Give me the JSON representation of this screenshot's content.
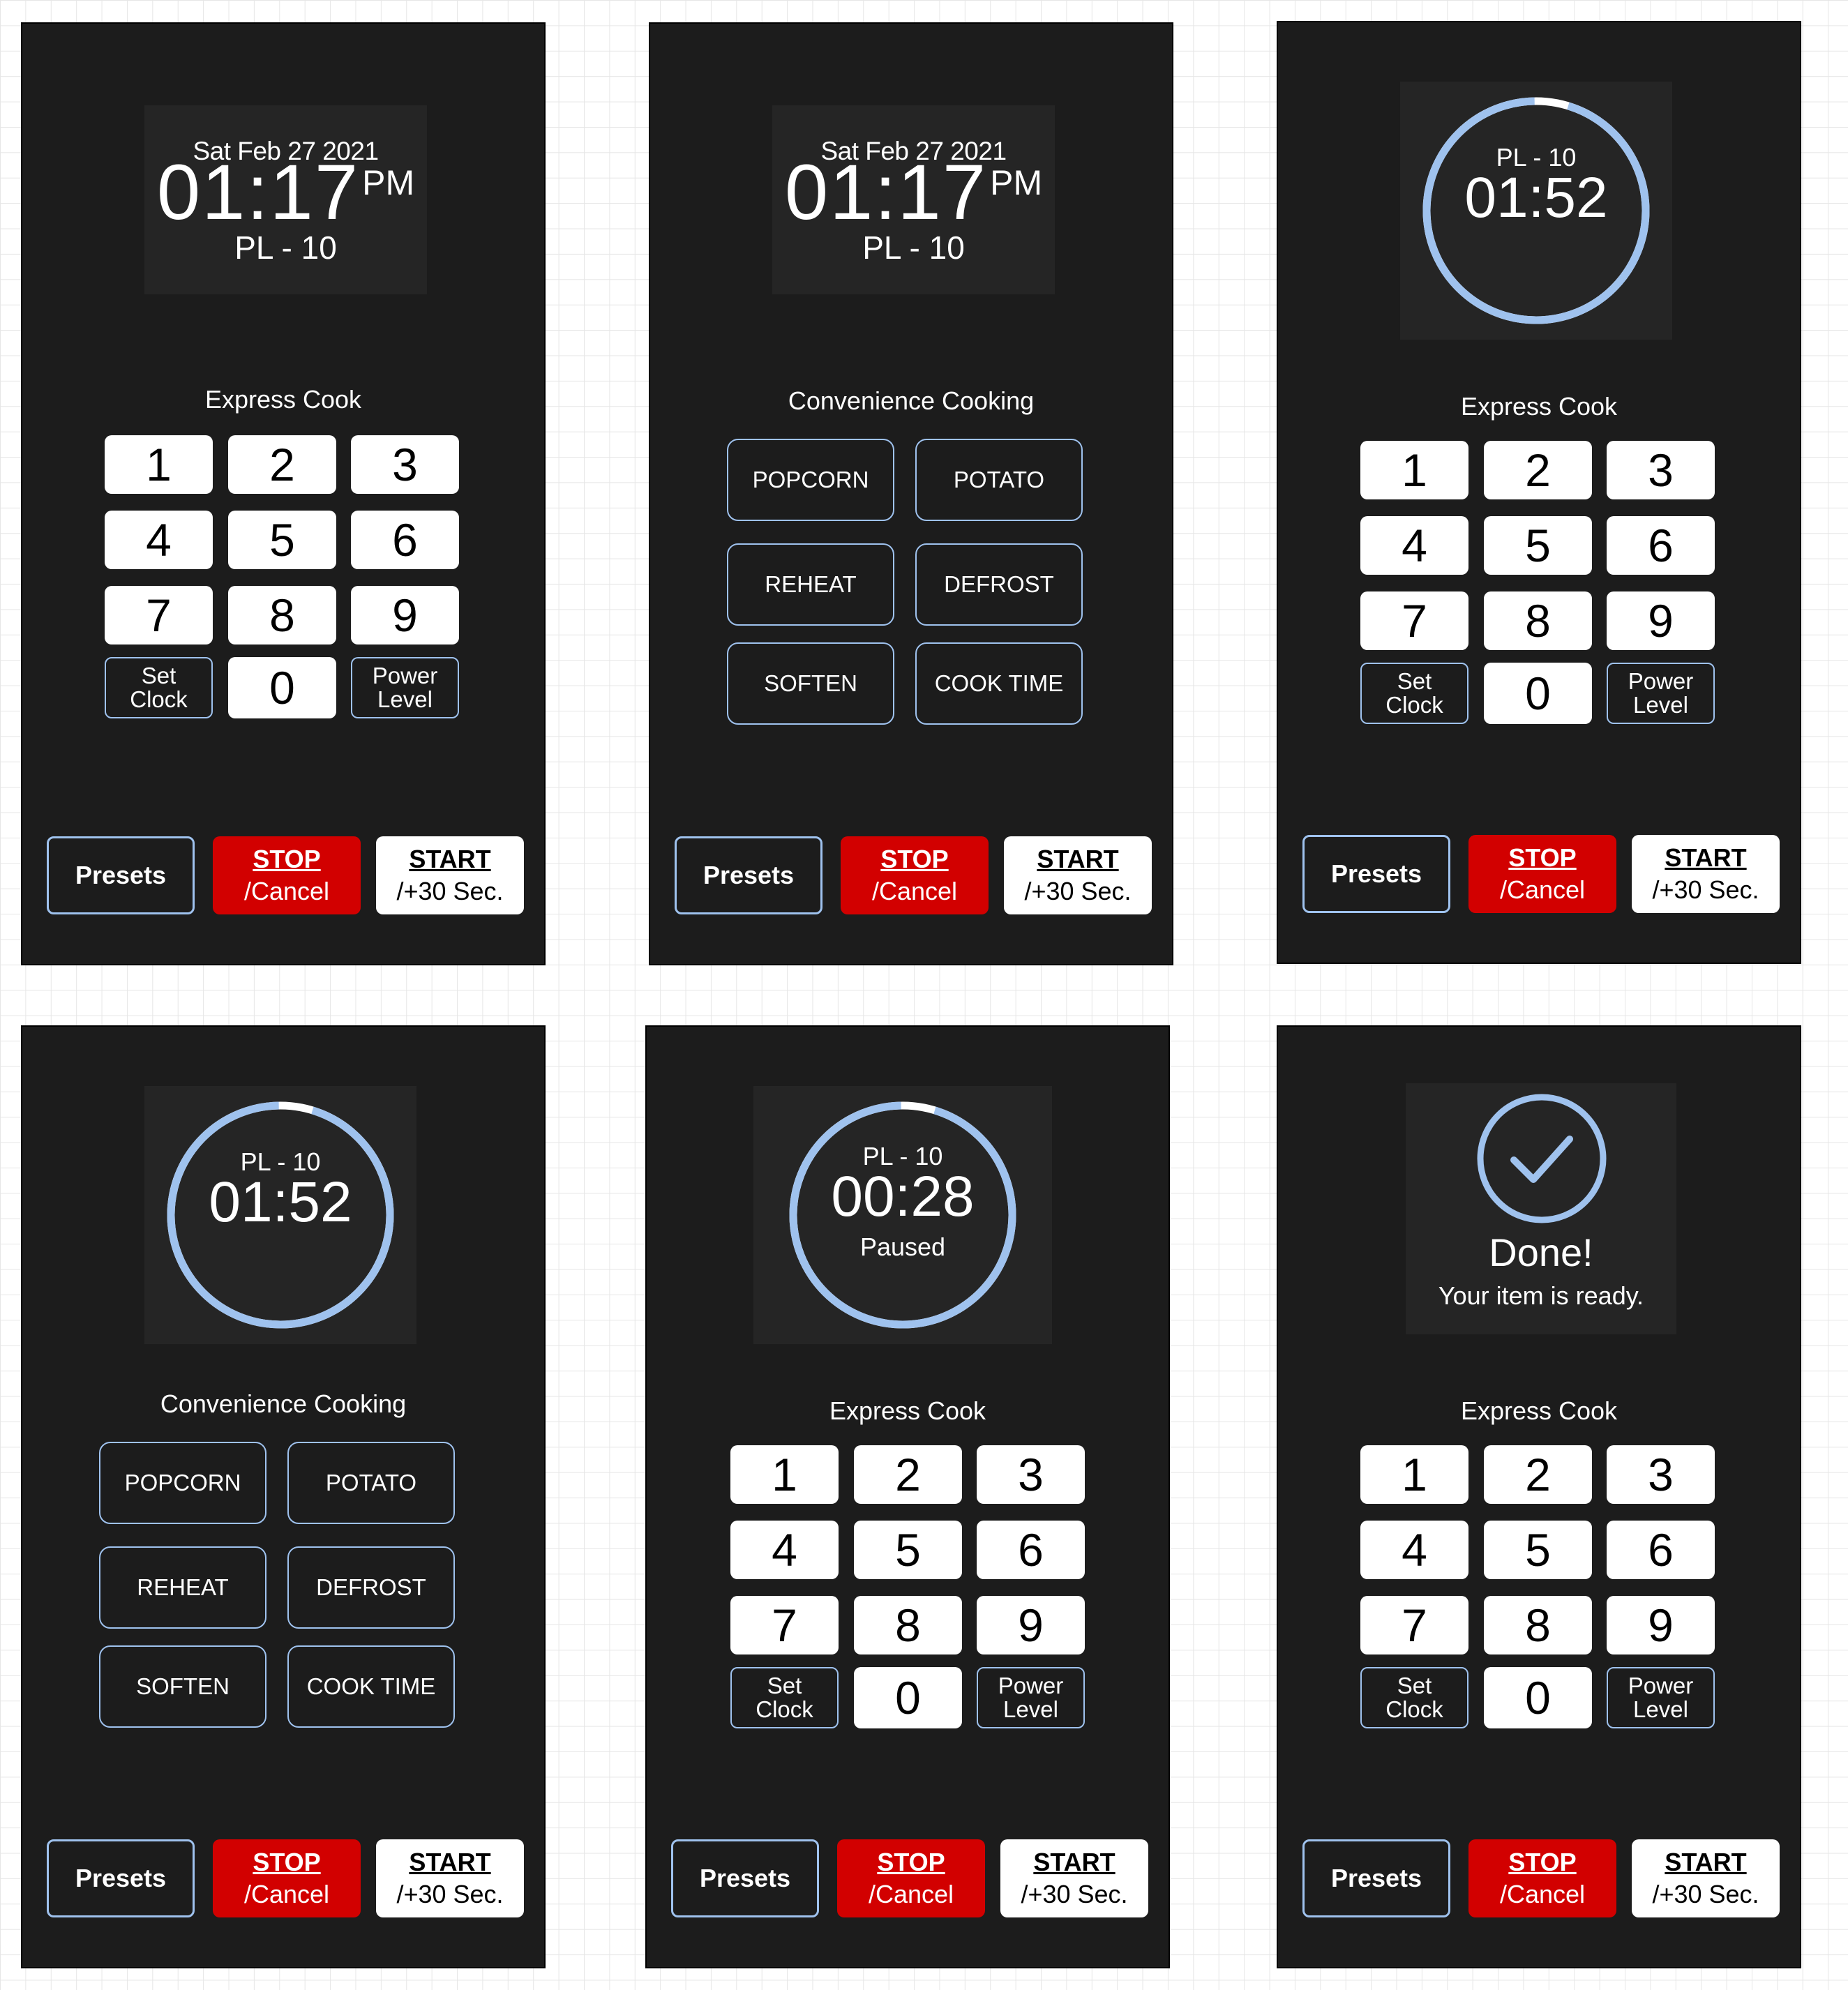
{
  "clock": {
    "date": "Sat Feb 27 2021",
    "time": "01:17",
    "ampm": "PM",
    "power_level": "PL - 10"
  },
  "cooking": {
    "power_level": "PL - 10",
    "time_running": "01:52",
    "time_paused": "00:28",
    "paused_label": "Paused",
    "progress_remaining": 0.95
  },
  "done": {
    "title": "Done!",
    "subtitle": "Your item is ready."
  },
  "sections": {
    "express": "Express Cook",
    "convenience": "Convenience Cooking"
  },
  "keypad": {
    "digits": [
      "1",
      "2",
      "3",
      "4",
      "5",
      "6",
      "7",
      "8",
      "9"
    ],
    "zero": "0",
    "set_clock": [
      "Set",
      "Clock"
    ],
    "power_level": [
      "Power",
      "Level"
    ]
  },
  "convenience_items": [
    "POPCORN",
    "POTATO",
    "REHEAT",
    "DEFROST",
    "SOFTEN",
    "COOK TIME"
  ],
  "controls": {
    "presets": "Presets",
    "stop_main": "STOP",
    "stop_sub": "/Cancel",
    "start_main": "START",
    "start_sub": "/+30 Sec."
  },
  "colors": {
    "panel": "#1c1c1c",
    "screen": "#252525",
    "accent": "#9fc2ee",
    "stop": "#d20000"
  }
}
